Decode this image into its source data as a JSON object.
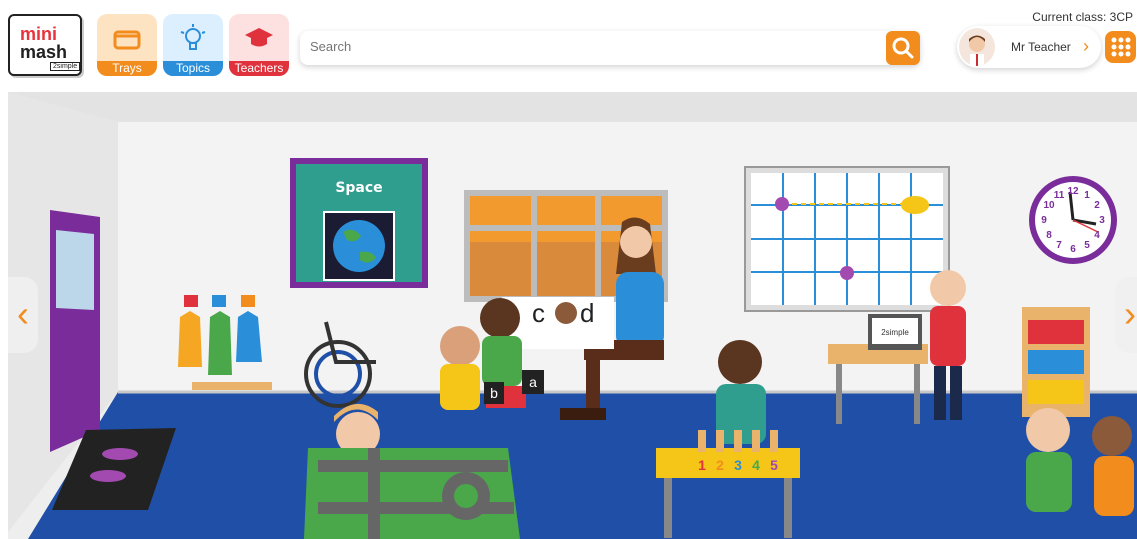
{
  "logo": {
    "line1_a": "mini",
    "line2": "mash",
    "badge": "2simple"
  },
  "nav": [
    {
      "label": "Trays",
      "icon": "tray-icon"
    },
    {
      "label": "Topics",
      "icon": "lightbulb-icon"
    },
    {
      "label": "Teachers",
      "icon": "graduation-cap-icon"
    }
  ],
  "search": {
    "placeholder": "Search"
  },
  "current_class": "Current class: 3CP",
  "user": {
    "name": "Mr Teacher"
  },
  "scene": {
    "space_board_title": "Space",
    "word_cards": [
      "c",
      "d"
    ],
    "letter_cards": [
      "b",
      "a"
    ],
    "number_board": [
      "1",
      "2",
      "3",
      "4",
      "5"
    ],
    "clock_numbers": [
      "12",
      "1",
      "2",
      "3",
      "4",
      "5",
      "6",
      "7",
      "8",
      "9",
      "10",
      "11"
    ],
    "laptop_label": "2simple"
  },
  "colors": {
    "orange": "#f28c1c",
    "blue": "#2a8fd8",
    "red": "#e0323c",
    "floor": "#1f4fa6",
    "wall": "#f1f1f1",
    "purple": "#7a2d9a"
  }
}
